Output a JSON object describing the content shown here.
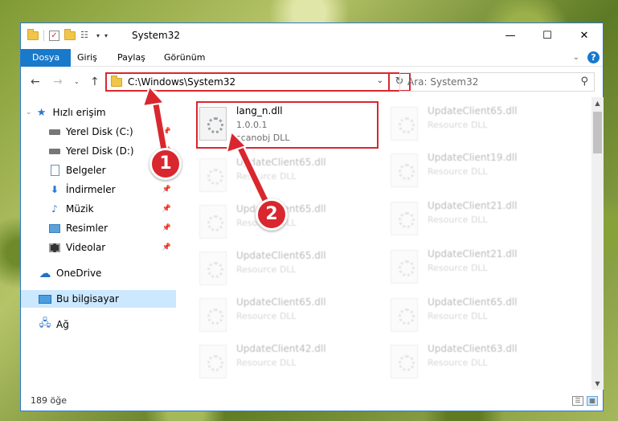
{
  "window": {
    "title": "System32",
    "controls": {
      "minimize": "—",
      "maximize": "☐",
      "close": "✕"
    }
  },
  "ribbon": {
    "tabs": [
      {
        "label": "Dosya",
        "active": true
      },
      {
        "label": "Giriş"
      },
      {
        "label": "Paylaş"
      },
      {
        "label": "Görünüm"
      }
    ],
    "help": "?"
  },
  "navigation": {
    "back": "←",
    "forward": "→",
    "recent": "⌄",
    "up": "↑",
    "address": "C:\\Windows\\System32",
    "refresh": "↻",
    "search_placeholder": "Ara: System32"
  },
  "sidebar": {
    "items": [
      {
        "label": "Hızlı erişim",
        "icon": "star-icon"
      },
      {
        "label": "Yerel Disk (C:)",
        "icon": "disk-icon",
        "pinned": true
      },
      {
        "label": "Yerel Disk (D:)",
        "icon": "disk-icon",
        "pinned": true
      },
      {
        "label": "Belgeler",
        "icon": "documents-icon"
      },
      {
        "label": "İndirmeler",
        "icon": "downloads-icon",
        "pinned": true
      },
      {
        "label": "Müzik",
        "icon": "music-icon",
        "pinned": true
      },
      {
        "label": "Resimler",
        "icon": "pictures-icon",
        "pinned": true
      },
      {
        "label": "Videolar",
        "icon": "videos-icon",
        "pinned": true
      },
      {
        "label": "OneDrive",
        "icon": "cloud-icon"
      },
      {
        "label": "Bu bilgisayar",
        "icon": "computer-icon",
        "selected": true
      },
      {
        "label": "Ağ",
        "icon": "network-icon"
      }
    ]
  },
  "files": {
    "highlighted": {
      "name": "lang_n.dll",
      "version": "1.0.0.1",
      "description": "scanobj DLL"
    },
    "left_column": [
      {
        "name": "UpdateClient65.dll",
        "description": "Resource DLL"
      },
      {
        "name": "UpdateClient65.dll",
        "description": "Resource DLL"
      },
      {
        "name": "UpdateClient65.dll",
        "description": "Resource DLL"
      },
      {
        "name": "UpdateClient65.dll",
        "description": "Resource DLL"
      },
      {
        "name": "UpdateClient42.dll",
        "description": "Resource DLL"
      }
    ],
    "right_column": [
      {
        "name": "UpdateClient65.dll",
        "description": "Resource DLL"
      },
      {
        "name": "UpdateClient19.dll",
        "description": "Resource DLL"
      },
      {
        "name": "UpdateClient21.dll",
        "description": "Resource DLL"
      },
      {
        "name": "UpdateClient21.dll",
        "description": "Resource DLL"
      },
      {
        "name": "UpdateClient65.dll",
        "description": "Resource DLL"
      },
      {
        "name": "UpdateClient63.dll",
        "description": "Resource DLL"
      }
    ]
  },
  "status": {
    "count": "189 öğe"
  },
  "annotations": {
    "step1": "1",
    "step2": "2",
    "color": "#d9272f"
  }
}
